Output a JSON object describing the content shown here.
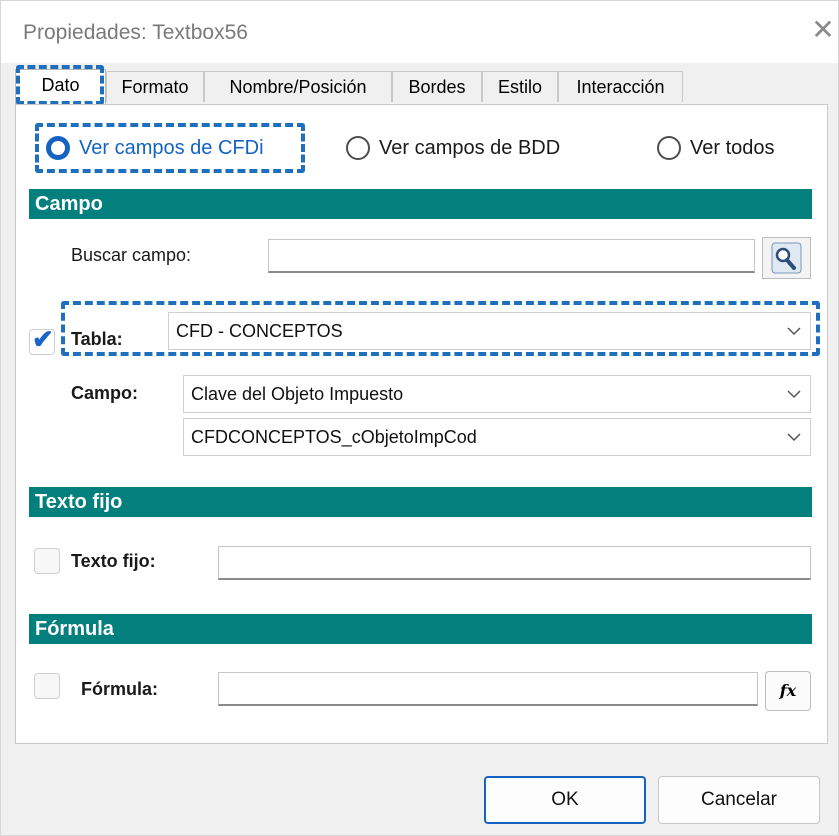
{
  "window": {
    "title": "Propiedades: Textbox56",
    "close_glyph": "✕"
  },
  "tabs": [
    {
      "label": "Dato",
      "active": true
    },
    {
      "label": "Formato"
    },
    {
      "label": "Nombre/Posición"
    },
    {
      "label": "Bordes"
    },
    {
      "label": "Estilo"
    },
    {
      "label": "Interacción"
    }
  ],
  "radios": [
    {
      "label": "Ver campos de CFDi",
      "checked": true
    },
    {
      "label": "Ver campos de BDD",
      "checked": false
    },
    {
      "label": "Ver todos",
      "checked": false
    }
  ],
  "campo_section": {
    "header": "Campo",
    "buscar_label": "Buscar campo:",
    "buscar_value": "",
    "tabla_label": "Tabla:",
    "tabla_checked": true,
    "tabla_value": "CFD - CONCEPTOS",
    "campo_label": "Campo:",
    "campo_value": "Clave del Objeto Impuesto",
    "campo_code_value": "CFDCONCEPTOS_cObjetoImpCod"
  },
  "texto_section": {
    "header": "Texto fijo",
    "label": "Texto fijo:",
    "checked": false,
    "value": ""
  },
  "formula_section": {
    "header": "Fórmula",
    "label": "Fórmula:",
    "checked": false,
    "value": "",
    "fx_label": "fx"
  },
  "buttons": {
    "ok": "OK",
    "cancel": "Cancelar"
  },
  "colors": {
    "section_header": "#037f7d",
    "accent": "#1463c2",
    "highlight": "#1f6fbf"
  },
  "icons": {
    "chevron": "chevron-down-icon",
    "search": "magnifier-icon",
    "check": "checkmark-icon"
  }
}
